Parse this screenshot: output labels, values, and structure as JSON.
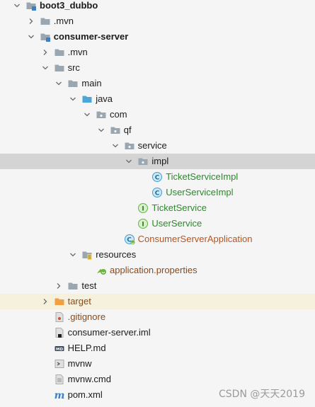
{
  "tree": {
    "rows": [
      {
        "label": "boot3_dubbo",
        "depth": 0,
        "arrow": "down",
        "icon": "module-folder-icon",
        "style": "bold"
      },
      {
        "label": ".mvn",
        "depth": 1,
        "arrow": "right",
        "icon": "folder-icon",
        "style": ""
      },
      {
        "label": "consumer-server",
        "depth": 1,
        "arrow": "down",
        "icon": "module-folder-icon",
        "style": "bold"
      },
      {
        "label": ".mvn",
        "depth": 2,
        "arrow": "right",
        "icon": "folder-icon",
        "style": ""
      },
      {
        "label": "src",
        "depth": 2,
        "arrow": "down",
        "icon": "folder-icon",
        "style": ""
      },
      {
        "label": "main",
        "depth": 3,
        "arrow": "down",
        "icon": "folder-icon",
        "style": ""
      },
      {
        "label": "java",
        "depth": 4,
        "arrow": "down",
        "icon": "source-folder-icon",
        "style": ""
      },
      {
        "label": "com",
        "depth": 5,
        "arrow": "down",
        "icon": "package-icon",
        "style": ""
      },
      {
        "label": "qf",
        "depth": 6,
        "arrow": "down",
        "icon": "package-icon",
        "style": ""
      },
      {
        "label": "service",
        "depth": 7,
        "arrow": "down",
        "icon": "package-icon",
        "style": ""
      },
      {
        "label": "impl",
        "depth": 8,
        "arrow": "down",
        "icon": "package-icon",
        "style": "",
        "state": "selected"
      },
      {
        "label": "TicketServiceImpl",
        "depth": 9,
        "arrow": "none",
        "icon": "class-icon",
        "style": "green"
      },
      {
        "label": "UserServiceImpl",
        "depth": 9,
        "arrow": "none",
        "icon": "class-icon",
        "style": "green"
      },
      {
        "label": "TicketService",
        "depth": 8,
        "arrow": "none",
        "icon": "interface-icon",
        "style": "green"
      },
      {
        "label": "UserService",
        "depth": 8,
        "arrow": "none",
        "icon": "interface-icon",
        "style": "green"
      },
      {
        "label": "ConsumerServerApplication",
        "depth": 7,
        "arrow": "none",
        "icon": "spring-boot-class-icon",
        "style": "orange"
      },
      {
        "label": "resources",
        "depth": 4,
        "arrow": "down",
        "icon": "resources-folder-icon",
        "style": ""
      },
      {
        "label": "application.properties",
        "depth": 5,
        "arrow": "none",
        "icon": "spring-properties-icon",
        "style": "brown"
      },
      {
        "label": "test",
        "depth": 3,
        "arrow": "right",
        "icon": "folder-icon",
        "style": ""
      },
      {
        "label": "target",
        "depth": 2,
        "arrow": "right",
        "icon": "excluded-folder-icon",
        "style": "brown",
        "state": "highlight"
      },
      {
        "label": ".gitignore",
        "depth": 2,
        "arrow": "none",
        "icon": "gitignore-file-icon",
        "style": "brown"
      },
      {
        "label": "consumer-server.iml",
        "depth": 2,
        "arrow": "none",
        "icon": "iml-file-icon",
        "style": ""
      },
      {
        "label": "HELP.md",
        "depth": 2,
        "arrow": "none",
        "icon": "markdown-file-icon",
        "style": ""
      },
      {
        "label": "mvnw",
        "depth": 2,
        "arrow": "none",
        "icon": "script-file-icon",
        "style": ""
      },
      {
        "label": "mvnw.cmd",
        "depth": 2,
        "arrow": "none",
        "icon": "text-file-icon",
        "style": ""
      },
      {
        "label": "pom.xml",
        "depth": 2,
        "arrow": "none",
        "icon": "maven-pom-icon",
        "style": ""
      }
    ]
  },
  "watermark": "CSDN @天天2019",
  "colors": {
    "selected_row": "#d4d4d4",
    "highlight_row": "#f6f1dc",
    "folder": "#9aa7b0",
    "source_folder": "#4aa8d8",
    "class_icon": "#3d9fd0",
    "interface_icon": "#62b543",
    "excluded_folder": "#f0a042",
    "green_text": "#2a8a2a",
    "orange_text": "#b8541b"
  }
}
